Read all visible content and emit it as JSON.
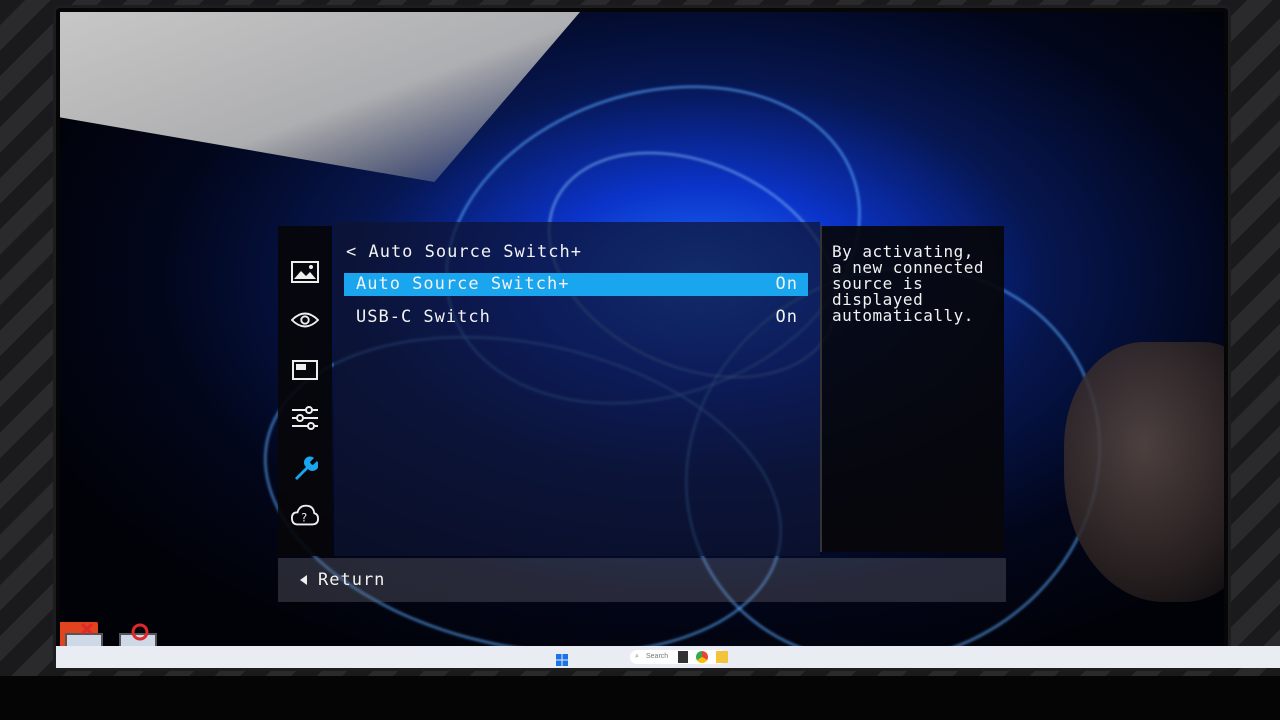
{
  "osd": {
    "breadcrumb": "< Auto Source Switch+",
    "rows": [
      {
        "label": "Auto Source Switch+",
        "value": "On",
        "selected": true
      },
      {
        "label": "USB-C Switch",
        "value": "On",
        "selected": false
      }
    ],
    "help_text": "By activating,\na new connected\nsource is\ndisplayed\nautomatically.",
    "return_label": "Return",
    "side_icons": [
      "picture-icon",
      "eye-icon",
      "screen-icon",
      "sliders-icon",
      "wrench-icon",
      "help-icon"
    ],
    "highlight_color": "#1aa6ee",
    "active_icon_color": "#1aa6ee"
  },
  "taskbar": {
    "search_placeholder": "Search"
  }
}
